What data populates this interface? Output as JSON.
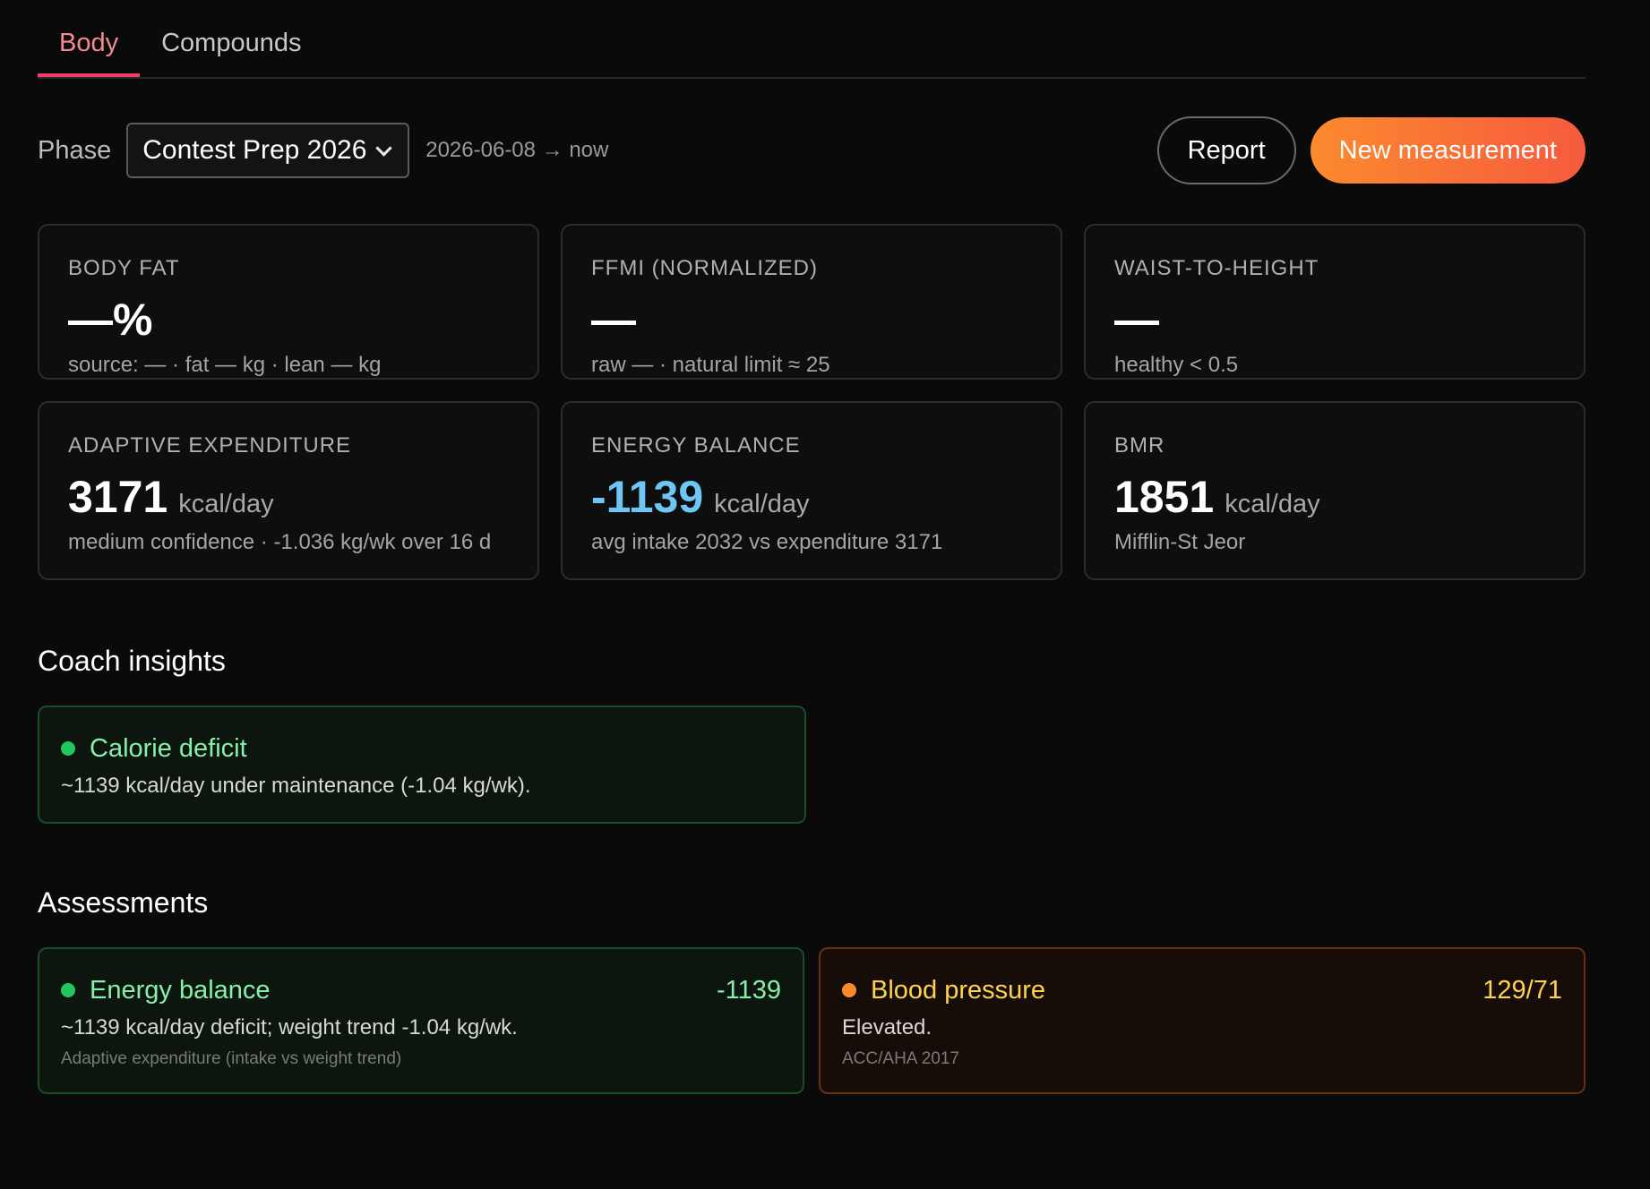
{
  "tabs": [
    {
      "label": "Body",
      "active": true
    },
    {
      "label": "Compounds",
      "active": false
    }
  ],
  "toolbar": {
    "phase_label": "Phase",
    "phase_selected": "Contest Prep 2026",
    "phase_range": "2026-06-08 → now",
    "report_label": "Report",
    "new_measurement_label": "New measurement"
  },
  "metrics": [
    {
      "label": "Body fat",
      "value": "—%",
      "unit": "",
      "sub": "source: — · fat — kg · lean — kg"
    },
    {
      "label": "FFMI (normalized)",
      "value": "—",
      "unit": "",
      "sub": "raw — · natural limit ≈ 25"
    },
    {
      "label": "Waist-to-height",
      "value": "—",
      "unit": "",
      "sub": "healthy < 0.5"
    },
    {
      "label": "Adaptive expenditure",
      "value": "3171",
      "unit": "kcal/day",
      "sub": "medium confidence · -1.036 kg/wk over 16 d"
    },
    {
      "label": "Energy balance",
      "value": "-1139",
      "unit": "kcal/day",
      "sub": "avg intake 2032 vs expenditure 3171",
      "value_color": "#6ec6f5"
    },
    {
      "label": "BMR",
      "value": "1851",
      "unit": "kcal/day",
      "sub": "Mifflin-St Jeor"
    }
  ],
  "coach": {
    "title": "Coach insights",
    "insights": [
      {
        "title": "Calorie deficit",
        "text": "~1139 kcal/day under maintenance (-1.04 kg/wk).",
        "status_color": "#22c55e"
      }
    ]
  },
  "assessments": {
    "title": "Assessments",
    "items": [
      {
        "title": "Energy balance",
        "value": "-1139",
        "text": "~1139 kcal/day deficit; weight trend -1.04 kg/wk.",
        "source": "Adaptive expenditure (intake vs weight trend)",
        "status_color": "#22c55e"
      },
      {
        "title": "Blood pressure",
        "value": "129/71",
        "text": "Elevated.",
        "source": "ACC/AHA 2017",
        "status_color": "#fb8a2e"
      }
    ]
  },
  "colors": {
    "accent_pink": "#ef3e6a",
    "button_gradient_start": "#fb8a2e",
    "button_gradient_end": "#f65a3e",
    "energy_balance_value": "#6ec6f5"
  }
}
